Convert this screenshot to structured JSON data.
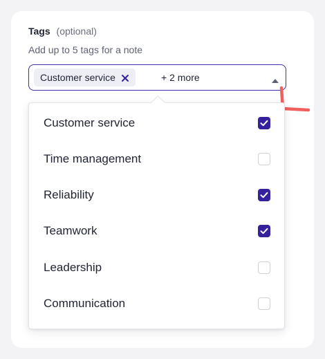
{
  "field": {
    "label": "Tags",
    "optional_text": "(optional)",
    "helper_text": "Add up to 5 tags for a note"
  },
  "select": {
    "chip_label": "Customer service",
    "more_text": "+ 2 more"
  },
  "options": [
    {
      "label": "Customer service",
      "checked": true
    },
    {
      "label": "Time management",
      "checked": false
    },
    {
      "label": "Reliability",
      "checked": true
    },
    {
      "label": "Teamwork",
      "checked": true
    },
    {
      "label": "Leadership",
      "checked": false
    },
    {
      "label": "Communication",
      "checked": false
    }
  ],
  "colors": {
    "accent": "#36209e",
    "select_border": "#3d2fa7",
    "chip_background": "#eeeef7",
    "cursor_annotation": "#f25f5c"
  },
  "icons": {
    "chip_remove": "close-icon",
    "dropdown_toggle": "caret-up-icon",
    "checkbox_checked": "checkmark-icon"
  }
}
